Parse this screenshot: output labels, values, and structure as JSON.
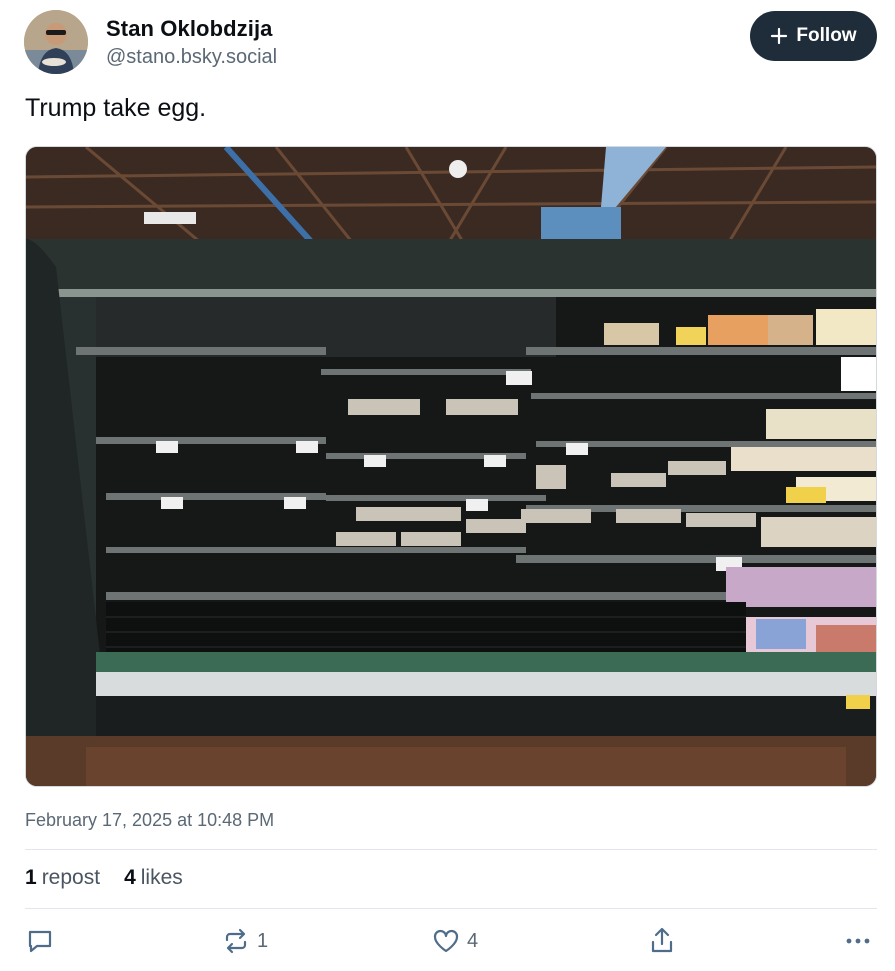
{
  "author": {
    "name": "Stan Oklobdzija",
    "handle": "@stano.bsky.social",
    "avatar_icon": "user-avatar"
  },
  "follow_button": {
    "label": "Follow",
    "icon": "plus-icon"
  },
  "post": {
    "text": "Trump take egg.",
    "image_icon": "grocery-store-empty-egg-shelves-photo",
    "timestamp": "February 17, 2025 at 10:48 PM"
  },
  "stats": {
    "reposts_count": "1",
    "reposts_label": "repost",
    "likes_count": "4",
    "likes_label": "likes"
  },
  "actions": {
    "reply_icon": "reply-icon",
    "repost_icon": "repost-icon",
    "repost_count": "1",
    "like_icon": "heart-icon",
    "like_count": "4",
    "share_icon": "share-icon",
    "more_icon": "more-icon"
  },
  "colors": {
    "follow_bg": "#1f2d3b",
    "muted_text": "#5b6875",
    "divider": "#e3e7eb"
  }
}
